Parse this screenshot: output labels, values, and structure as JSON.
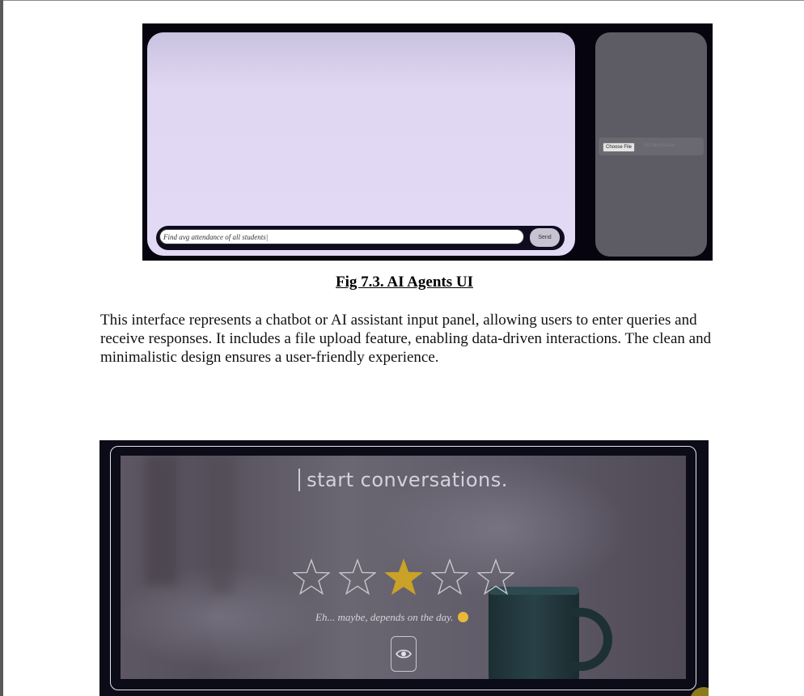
{
  "figure1": {
    "chat_input_value": "Find avg attendance of all students|",
    "send_label": "Send",
    "choose_file_label": "Choose File",
    "no_file_text": "No file chosen"
  },
  "caption": "Fig 7.3. AI Agents UI",
  "paragraph": "This interface represents a chatbot or AI assistant input panel, allowing users to enter queries and receive responses. It includes a file upload feature, enabling data-driven interactions. The clean and minimalistic design ensures a user-friendly experience.",
  "figure2": {
    "headline": "start conversations.",
    "rating_value": 3,
    "rating_max": 5,
    "rating_text": "Eh... maybe, depends on the day.",
    "colors": {
      "star_filled": "#c9a227",
      "star_outline": "#c8c6cc"
    },
    "icons": {
      "eye": "eye-icon",
      "emoji": "grimace-emoji-icon"
    }
  }
}
